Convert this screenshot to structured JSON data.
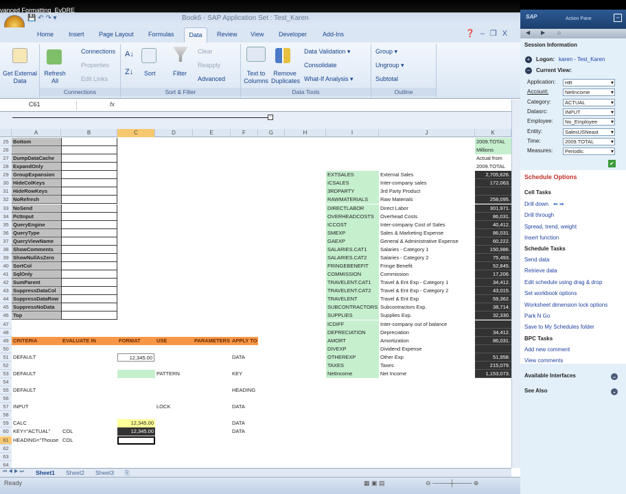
{
  "window": {
    "doc_title": "vanced Formatting_EvDRE",
    "app_title": "Book6 - SAP   Application Set : Test_Karen"
  },
  "tabs": [
    "Home",
    "Insert",
    "Page Layout",
    "Formulas",
    "Data",
    "Review",
    "View",
    "Developer",
    "Add-Ins"
  ],
  "ribbon": {
    "get_external": "Get External Data",
    "refresh": "Refresh All",
    "connections": "Connections",
    "properties": "Properties",
    "edit_links": "Edit Links",
    "sort": "Sort",
    "filter": "Filter",
    "clear": "Clear",
    "reapply": "Reapply",
    "advanced": "Advanced",
    "text_to_columns": "Text to Columns",
    "remove_duplicates": "Remove Duplicates",
    "data_validation": "Data Validation ▾",
    "consolidate": "Consolidate",
    "what_if": "What-If Analysis ▾",
    "group": "Group ▾",
    "ungroup": "Ungroup ▾",
    "subtotal": "Subtotal",
    "groups": [
      "Connections",
      "Sort & Filter",
      "Data Tools",
      "Outline"
    ]
  },
  "formula_bar": {
    "name_box": "C61",
    "fx": "fx",
    "value": ""
  },
  "columns": [
    "A",
    "B",
    "C",
    "D",
    "E",
    "F",
    "G",
    "H",
    "I",
    "J",
    "K"
  ],
  "rows": [
    {
      "n": 25,
      "A": "Bottom",
      "K": "2009.TOTAL"
    },
    {
      "n": 26,
      "A": "",
      "K": "Millions"
    },
    {
      "n": 27,
      "A": "DumpDataCache",
      "K": "Actual from"
    },
    {
      "n": 28,
      "A": "ExpandOnly",
      "K": "2009.TOTAL"
    },
    {
      "n": 29,
      "A": "GroupExpansion",
      "I": "EXTSALES",
      "J": "External Sales",
      "K": "2,705,626."
    },
    {
      "n": 30,
      "A": "HideColKeys",
      "I": "ICSALES",
      "J": "Inter-company sales",
      "K": "172,063."
    },
    {
      "n": 31,
      "A": "HideRowKeys",
      "I": "3RDPARTY",
      "J": "3rd Party Product",
      "K": ""
    },
    {
      "n": 32,
      "A": "NoRefresh",
      "I": "RAWMATERIALS",
      "J": "Raw Materials",
      "K": "258,095."
    },
    {
      "n": 33,
      "A": "NoSend",
      "I": "DIRECTLABOR",
      "J": "Direct Labor",
      "K": "301,971."
    },
    {
      "n": 34,
      "A": "PctInput",
      "I": "OVERHEADCOSTS",
      "J": "Overhead Costs",
      "K": "86,031."
    },
    {
      "n": 35,
      "A": "QueryEngine",
      "I": "ICCOST",
      "J": "Inter-company Cost of Sales",
      "K": "40,412."
    },
    {
      "n": 36,
      "A": "QueryType",
      "I": "SMEXP",
      "J": "Sales & Marketing Expense",
      "K": "86,031."
    },
    {
      "n": 37,
      "A": "QueryViewName",
      "I": "GAEXP",
      "J": "General & Administrative Expense",
      "K": "60,222."
    },
    {
      "n": 38,
      "A": "ShowComments",
      "I": "SALARIES.CAT1",
      "J": "Salaries - Category 1",
      "K": "150,986."
    },
    {
      "n": 39,
      "A": "ShowNullAsZero",
      "I": "SALARIES.CAT2",
      "J": "Salaries - Category 2",
      "K": "75,493."
    },
    {
      "n": 40,
      "A": "SortCol",
      "I": "FRINGEBENEFIT",
      "J": "Fringe Benefit",
      "K": "52,845."
    },
    {
      "n": 41,
      "A": "SqlOnly",
      "I": "COMMISSION",
      "J": "Commission",
      "K": "17,206."
    },
    {
      "n": 42,
      "A": "SumParent",
      "I": "TRAVELENT.CAT1",
      "J": "Travel & Ent Exp - Category 1",
      "K": "34,412."
    },
    {
      "n": 43,
      "A": "SuppressDataCol",
      "I": "TRAVELENT.CAT2",
      "J": "Travel & Ent Exp - Category 2",
      "K": "43,015."
    },
    {
      "n": 44,
      "A": "SuppressDataRow",
      "I": "TRAVELENT",
      "J": "Travel & Ent Exp",
      "K": "59,362."
    },
    {
      "n": 45,
      "A": "SuppressNoData",
      "I": "SUBCONTRACTORS",
      "J": "Subcontractors Exp.",
      "K": "38,714."
    },
    {
      "n": 46,
      "A": "Top",
      "I": "SUPPLIES",
      "J": "Supplies Exp.",
      "K": "32,330."
    },
    {
      "n": 47,
      "I": "ICDIFF",
      "J": "Inter-company out of balance",
      "K": ""
    },
    {
      "n": 48,
      "I": "DEPRECIATION",
      "J": "Depreciation",
      "K": "34,412."
    },
    {
      "n": 49,
      "A": "CRITERIA",
      "B": "EVALUATE IN",
      "C": "FORMAT",
      "D": "USE",
      "E": "PARAMETERS",
      "F": "APPLY TO",
      "I": "AMORT",
      "J": "Amortization",
      "K": "86,031."
    },
    {
      "n": 50,
      "I": "DIVEXP",
      "J": "Dividend Expense",
      "K": ""
    },
    {
      "n": 51,
      "A": "DEFAULT",
      "C": "12,345.00",
      "F": "DATA",
      "I": "OTHEREXP",
      "J": "Other Exp",
      "K": "51,958."
    },
    {
      "n": 52,
      "I": "TAXES",
      "J": "Taxes",
      "K": "215,079."
    },
    {
      "n": 53,
      "A": "DEFAULT",
      "D": "PATTERN",
      "F": "KEY",
      "I": "NetIncome",
      "J": "Net Income",
      "K": "1,153,073."
    },
    {
      "n": 54
    },
    {
      "n": 55,
      "A": "DEFAULT",
      "F": "HEADING"
    },
    {
      "n": 56
    },
    {
      "n": 57,
      "A": "INPUT",
      "D": "LOCK",
      "F": "DATA"
    },
    {
      "n": 58
    },
    {
      "n": 59,
      "A": "CALC",
      "C": "12,345.00",
      "F": "DATA"
    },
    {
      "n": 60,
      "A": "KEY=\"ACTUAL\"",
      "B": "COL",
      "C": "12,345.00",
      "F": "DATA"
    },
    {
      "n": 61,
      "A": "HEADING=\"Thouse",
      "B": "COL"
    },
    {
      "n": 62
    },
    {
      "n": 63
    },
    {
      "n": 64
    }
  ],
  "sheets": [
    "Sheet1",
    "Sheet2",
    "Sheet3"
  ],
  "status": "Ready",
  "action_pane": {
    "title": "Action Pane",
    "session_info": "Session Information",
    "logon_label": "Logon:",
    "logon_value": "karen - Test_Karen",
    "current_view": "Current View:",
    "fields": [
      {
        "label": "Application:",
        "value": "HR"
      },
      {
        "label": "Account:",
        "value": "NetIncome"
      },
      {
        "label": "Category:",
        "value": "ACTUAL"
      },
      {
        "label": "Datasrc:",
        "value": "INPUT"
      },
      {
        "label": "Employee:",
        "value": "No_Employee"
      },
      {
        "label": "Entity:",
        "value": "SalesUSNeast"
      },
      {
        "label": "Time:",
        "value": "2009.TOTAL"
      },
      {
        "label": "Measures:",
        "value": "Periodic"
      }
    ],
    "schedule_options": "Schedule Options",
    "cell_tasks": "Cell Tasks",
    "cell_links": [
      "Drill down",
      "Drill through",
      "Spread,  trend,  weight",
      "Insert function"
    ],
    "schedule_tasks": "Schedule Tasks",
    "schedule_links": [
      "Send data",
      "Retrieve data",
      "Edit schedule using drag & drop",
      "Set workbook options",
      "Worksheet dimension lock options",
      "Park N Go",
      "Save to My Schedules folder"
    ],
    "bpc_tasks": "BPC Tasks",
    "bpc_links": [
      "Add new comment",
      "View comments"
    ],
    "available_interfaces": "Available Interfaces",
    "see_also": "See Also"
  },
  "colors": {
    "green": "#c6efce",
    "dark": "#333333",
    "orange": "#f79646",
    "yellow": "#ffff99",
    "gray": "#c0c0c0"
  }
}
